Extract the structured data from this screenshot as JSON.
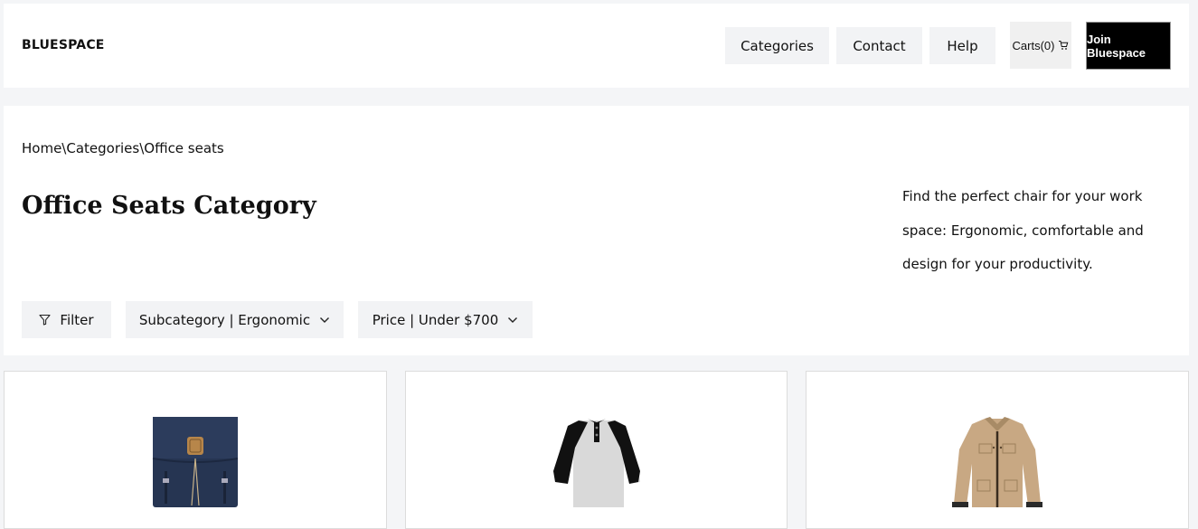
{
  "header": {
    "brand": "BLUESPACE",
    "nav": [
      "Categories",
      "Contact",
      "Help"
    ],
    "cart_label": "Carts(0)",
    "join_label": "Join Bluespace"
  },
  "hero": {
    "breadcrumb": "Home\\Categories\\Office seats",
    "title": "Office Seats Category",
    "description": "Find the perfect chair for your work space: Ergonomic, comfortable and design for your productivity."
  },
  "filters": {
    "filter_label": "Filter",
    "subcategory_label": "Subcategory | Ergonomic",
    "price_label": "Price | Under $700"
  },
  "products": [
    {
      "icon": "backpack-image"
    },
    {
      "icon": "raglan-shirt-image"
    },
    {
      "icon": "jacket-image"
    }
  ]
}
